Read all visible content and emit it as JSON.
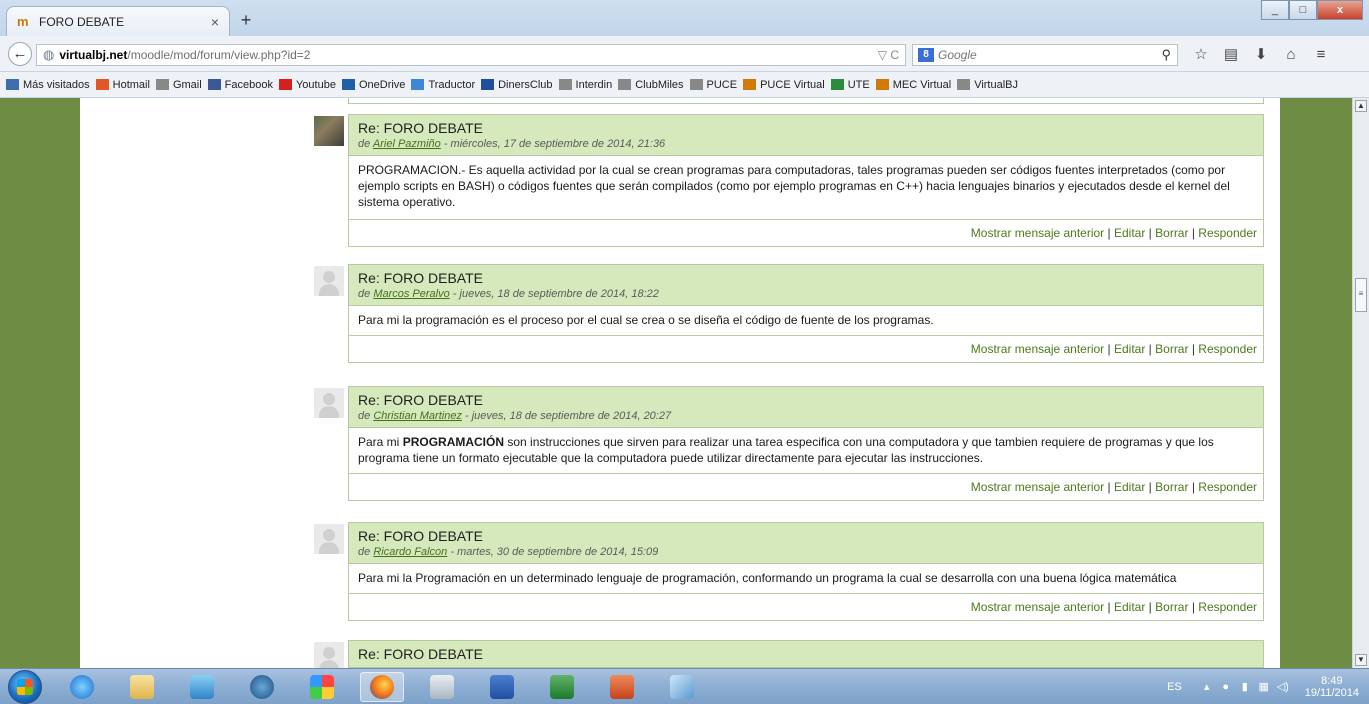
{
  "browser": {
    "tab_title": "FORO DEBATE",
    "tab_close": "×",
    "new_tab": "+",
    "url_domain": "virtualbj.net",
    "url_path": "/moodle/mod/forum/view.php?id=2",
    "search_placeholder": "Google",
    "bookmarks": [
      {
        "label": "Más visitados",
        "icon": "bookmark-icon",
        "color": "#3d6fb0"
      },
      {
        "label": "Hotmail",
        "icon": "windows-icon",
        "color": "#e2572a"
      },
      {
        "label": "Gmail",
        "icon": "page-icon",
        "color": "#888888"
      },
      {
        "label": "Facebook",
        "icon": "facebook-icon",
        "color": "#3b5998"
      },
      {
        "label": "Youtube",
        "icon": "youtube-icon",
        "color": "#d62020"
      },
      {
        "label": "OneDrive",
        "icon": "cloud-icon",
        "color": "#1e5fa8"
      },
      {
        "label": "Traductor",
        "icon": "translate-icon",
        "color": "#3f86d6"
      },
      {
        "label": "DinersClub",
        "icon": "diners-icon",
        "color": "#1d4f9b"
      },
      {
        "label": "Interdin",
        "icon": "page-icon",
        "color": "#888888"
      },
      {
        "label": "ClubMiles",
        "icon": "page-icon",
        "color": "#888888"
      },
      {
        "label": "PUCE",
        "icon": "page-icon",
        "color": "#888888"
      },
      {
        "label": "PUCE Virtual",
        "icon": "moodle-icon",
        "color": "#d17a05"
      },
      {
        "label": "UTE",
        "icon": "globe-icon",
        "color": "#2b8c3a"
      },
      {
        "label": "MEC Virtual",
        "icon": "moodle-icon",
        "color": "#d17a05"
      },
      {
        "label": "VirtualBJ",
        "icon": "page-icon",
        "color": "#888888"
      }
    ]
  },
  "forum": {
    "posts": [
      {
        "subject": "Re: FORO DEBATE",
        "by": "de",
        "author": "Ariel Pazmiño",
        "date": " - miércoles, 17 de septiembre de 2014, 21:36",
        "message": "PROGRAMACION.- Es aquella actividad por la cual se crean programas para computadoras, tales programas pueden ser códigos fuentes interpretados (como por ejemplo scripts en BASH) o códigos fuentes que serán compilados (como por ejemplo programas en C++) hacia lenguajes binarios y ejecutados desde el kernel del sistema operativo."
      },
      {
        "subject": "Re: FORO DEBATE",
        "by": "de",
        "author": "Marcos Peralvo",
        "date": " - jueves, 18 de septiembre de 2014, 18:22",
        "message": "Para mi la programación es el proceso por el cual se crea o se diseña el código de fuente de los programas."
      },
      {
        "subject": "Re: FORO DEBATE",
        "by": "de",
        "author": "Christian Martinez",
        "date": " - jueves, 18 de septiembre de 2014, 20:27",
        "message_pre": "Para mi ",
        "message_bold": "PROGRAMACIÓN",
        "message_post": " son instrucciones que sirven para realizar una tarea especifica con una computadora y que tambien requiere de programas y que los programa tiene un formato ejecutable que la computadora puede utilizar directamente para ejecutar las instrucciones."
      },
      {
        "subject": "Re: FORO DEBATE",
        "by": "de",
        "author": "Ricardo Falcon",
        "date": " - martes, 30 de septiembre de 2014, 15:09",
        "message": "Para mi la Programación  en un determinado lenguaje de programación, conformando un programa la cual se desarrolla con una buena lógica matemática"
      },
      {
        "subject": "Re: FORO DEBATE"
      }
    ],
    "commands": {
      "show_parent": "Mostrar mensaje anterior",
      "edit": "Editar",
      "delete": "Borrar",
      "reply": "Responder",
      "sep": " | "
    }
  },
  "taskbar": {
    "lang": "ES",
    "time": "8:49",
    "date": "19/11/2014"
  }
}
